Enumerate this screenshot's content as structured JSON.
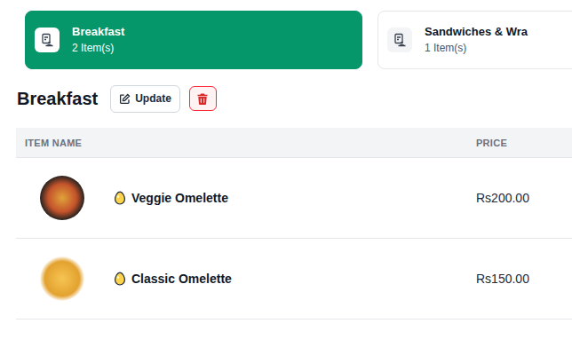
{
  "categories": [
    {
      "name": "Breakfast",
      "count": "2 Item(s)",
      "selected": true
    },
    {
      "name": "Sandwiches & Wra",
      "count": "1 Item(s)",
      "selected": false
    }
  ],
  "section": {
    "title": "Breakfast",
    "buttons": [
      "Update"
    ]
  },
  "table": {
    "columns": [
      "ITEM NAME",
      "PRICE"
    ],
    "rows": [
      {
        "name": "Veggie Omelette",
        "price": "Rs200.00"
      },
      {
        "name": "Classic Omelette",
        "price": "Rs150.00"
      }
    ]
  }
}
